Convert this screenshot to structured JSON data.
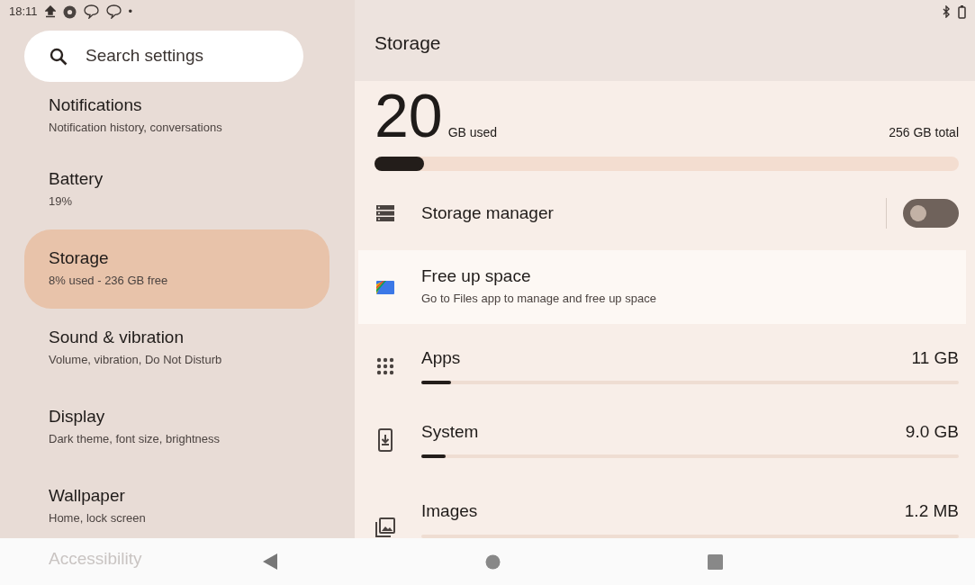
{
  "status_bar": {
    "time": "18:11",
    "dot": "•"
  },
  "search": {
    "placeholder": "Search settings"
  },
  "sidebar": {
    "items": [
      {
        "title": "Notifications",
        "subtitle": "Notification history, conversations",
        "selected": false
      },
      {
        "title": "Battery",
        "subtitle": "19%",
        "selected": false
      },
      {
        "title": "Storage",
        "subtitle": "8% used - 236 GB free",
        "selected": true
      },
      {
        "title": "Sound & vibration",
        "subtitle": "Volume, vibration, Do Not Disturb",
        "selected": false
      },
      {
        "title": "Display",
        "subtitle": "Dark theme, font size, brightness",
        "selected": false
      },
      {
        "title": "Wallpaper",
        "subtitle": "Home, lock screen",
        "selected": false
      },
      {
        "title": "Accessibility",
        "selected": false
      }
    ]
  },
  "page": {
    "title": "Storage",
    "usage": {
      "used": "20",
      "used_label": "GB used",
      "total": "256 GB total",
      "level": 0.084
    },
    "storage_manager": {
      "title": "Storage manager",
      "on": false
    },
    "free_up": {
      "title": "Free up space",
      "subtitle": "Go to Files app to manage and free up space"
    },
    "categories": [
      {
        "kind": "apps",
        "name": "Apps",
        "size": "11 GB",
        "level": 0.055
      },
      {
        "kind": "system",
        "name": "System",
        "size": "9.0 GB",
        "level": 0.045
      },
      {
        "kind": "images",
        "name": "Images",
        "size": "1.2 MB",
        "level": 0.0
      }
    ]
  }
}
